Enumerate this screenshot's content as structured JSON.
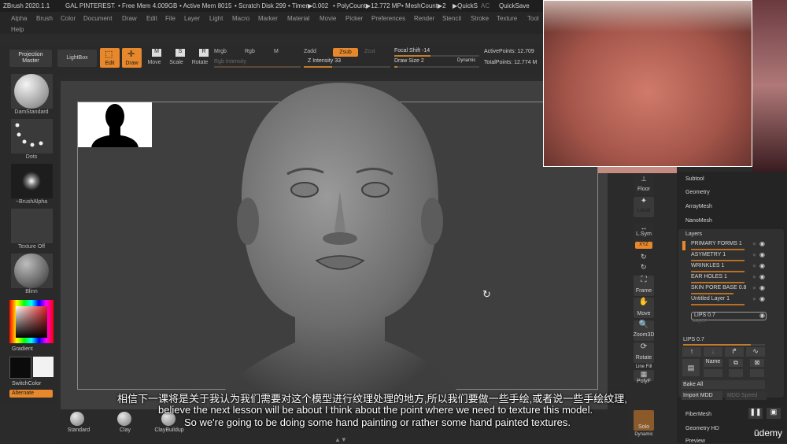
{
  "titlebar": {
    "app": "ZBrush 2020.1.1",
    "project": "GAL PINTEREST",
    "free_mem": "• Free Mem 4.009GB",
    "active_mem": "• Active Mem 8015",
    "scratch": "• Scratch Disk 299",
    "timer": "• Timer▶0.002",
    "polycount": "• PolyCount▶12.772 MP",
    "meshcount": "• MeshCount▶2",
    "quicks": "▶QuickS",
    "ac": "AC",
    "quicksave": "QuickSave"
  },
  "menubar": {
    "items": [
      "Alpha",
      "Brush",
      "Color",
      "Document",
      "Draw",
      "Edit",
      "File",
      "Layer",
      "Light",
      "Macro",
      "Marker",
      "Material",
      "Movie",
      "Picker",
      "Preferences",
      "Render",
      "Stencil",
      "Stroke",
      "Texture",
      "Tool"
    ],
    "help": "Help"
  },
  "toolbar": {
    "projection_master": "Projection Master",
    "lightbox": "LightBox",
    "edit": "Edit",
    "draw": "Draw",
    "move": "Move",
    "scale": "Scale",
    "rotate": "Rotate",
    "mrgb": "Mrgb",
    "rgb": "Rgb",
    "m": "M",
    "rgb_intensity": "Rgb Intensity",
    "zadd": "Zadd",
    "zsub": "Zsub",
    "zcut": "Zcut",
    "z_intensity": "Z Intensity 33",
    "focal_shift": "Focal Shift -14",
    "draw_size": "Draw Size 2",
    "dynamic": "Dynamic",
    "active_points": "ActivePoints: 12.709",
    "total_points": "TotalPoints: 12.774 M"
  },
  "left": {
    "brush": "DamStandard",
    "stroke": "Dots",
    "alpha": "~BrushAlpha",
    "texture": "Texture Off",
    "material": "Blinn",
    "gradient": "Gradient",
    "switchcolor": "SwitchColor",
    "alternate": "Alternate",
    "main_color": "#0b0b0b",
    "secondary_color": "#f2f2f2"
  },
  "bottom_brushes": [
    {
      "name": "Standard"
    },
    {
      "name": "Clay"
    },
    {
      "name": "ClayBuildup"
    }
  ],
  "viewbar": {
    "floor": "Floor",
    "local": "Local",
    "lsym": "L.Sym",
    "xyz": "XYZ",
    "frame": "Frame",
    "move": "Move",
    "zoom3d": "Zoom3D",
    "rotate": "Rotate",
    "linefill": "Line Fill",
    "polyf": "PolyF",
    "solo": "Solo",
    "dynamic": "Dynamic"
  },
  "rightpanel": {
    "subtool": "Subtool",
    "geometry": "Geometry",
    "arraymesh": "ArrayMesh",
    "nanomesh": "NanoMesh",
    "layers_title": "Layers",
    "layers": [
      {
        "name": "PRIMARY FORMS",
        "value": "1",
        "fill": 1.0
      },
      {
        "name": "ASYMETRY",
        "value": "1",
        "fill": 1.0
      },
      {
        "name": "WRINKLES",
        "value": "1",
        "fill": 1.0
      },
      {
        "name": "EAR HOLES",
        "value": "1",
        "fill": 1.0
      },
      {
        "name": "SKIN PORE BASE",
        "value": "0.8",
        "fill": 0.8
      },
      {
        "name": "Untitled Layer",
        "value": "1",
        "fill": 1.0
      },
      {
        "name": "LIPS",
        "value": "0.7",
        "fill": 0.7
      }
    ],
    "layer_slider": "Layer",
    "lips_slider": "LIPS 0.7",
    "name_btn": "Name",
    "bake_all": "Bake All",
    "import_mdd": "Import MDD",
    "mdd_speed": "MDD Speed",
    "fibermesh": "FiberMesh",
    "geometry_hd": "Geometry HD",
    "preview": "Preview"
  },
  "subtitles": {
    "zh": "相信下一课将是关于我认为我们需要对这个模型进行纹理处理的地方,所以我们要做一些手绘,或者说一些手绘纹理,",
    "en1": "believe the next lesson will be about I think about the point where we need to texture this model.",
    "en2": "So we're going to be doing some hand painting or rather some hand painted textures."
  },
  "watermark": "ūdemy"
}
